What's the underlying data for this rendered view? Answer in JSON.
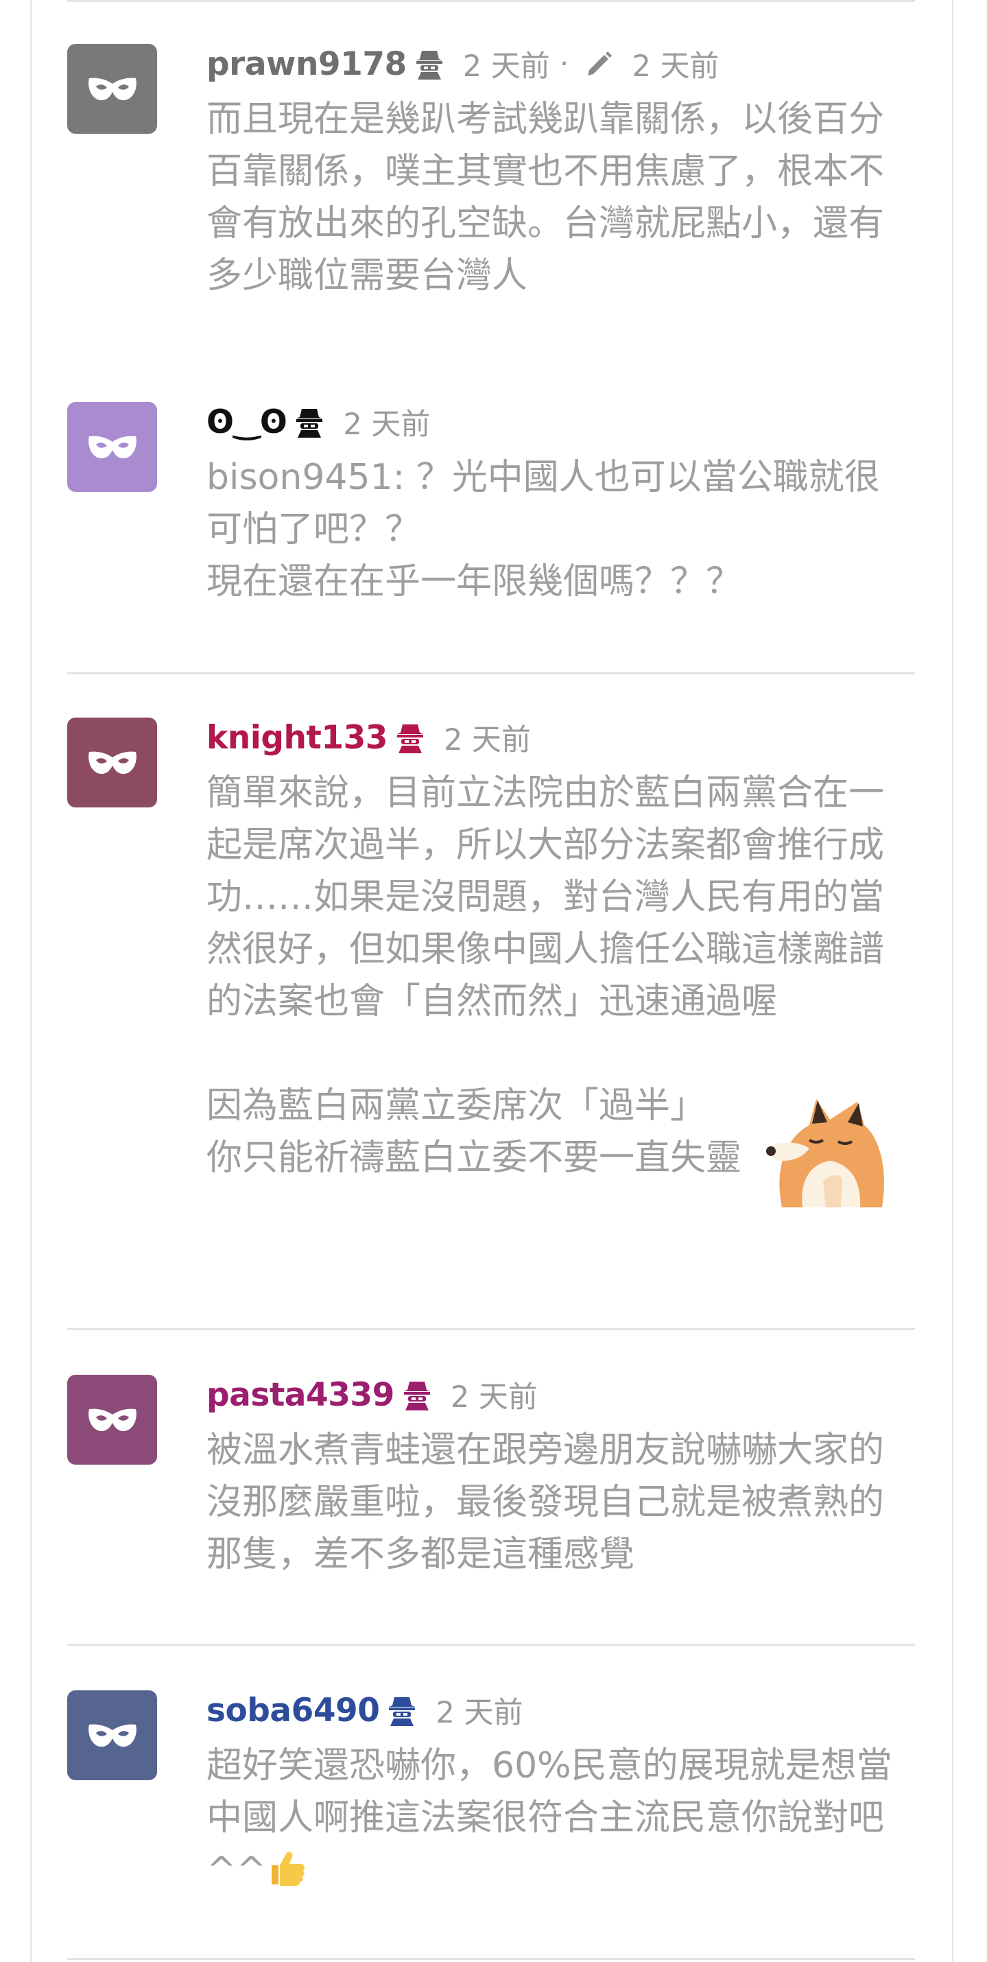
{
  "comments": [
    {
      "username": "prawn9178",
      "username_color": "#6f6f6f",
      "avatar_color": "#7a7878",
      "time": "2 天前",
      "edited_sep": "·",
      "edited_time": "2 天前",
      "text": "而且現在是幾趴考試幾趴靠關係，以後百分百靠關係，噗主其實也不用焦慮了，根本不會有放出來的孔空缺。台灣就屁點小，還有多少職位需要台灣人"
    },
    {
      "username": "ʘ‿ʘ",
      "username_color": "#111111",
      "avatar_color": "#a98bd0",
      "time": "2 天前",
      "text": "bison9451: ？光中國人也可以當公職就很可怕了吧？？\n現在還在在乎一年限幾個嗎？？？"
    },
    {
      "username": "knight133",
      "username_color": "#b3174d",
      "avatar_color": "#8d4a63",
      "time": "2 天前",
      "text": "簡單來說，目前立法院由於藍白兩黨合在一起是席次過半，所以大部分法案都會推行成功……如果是沒問題，對台灣人民有用的當然很好，但如果像中國人擔任公職這樣離譜的法案也會「自然而然」迅速通過喔\n\n因為藍白兩黨立委席次「過半」\n你只能祈禱藍白立委不要一直失靈"
    },
    {
      "username": "pasta4339",
      "username_color": "#9c1e6e",
      "avatar_color": "#8b4a78",
      "time": "2 天前",
      "text": "被溫水煮青蛙還在跟旁邊朋友說嚇嚇大家的沒那麼嚴重啦，最後發現自己就是被煮熟的那隻，差不多都是這種感覺"
    },
    {
      "username": "soba6490",
      "username_color": "#2d4d9a",
      "avatar_color": "#56658f",
      "time": "2 天前",
      "text": "超好笑還恐嚇你，60%民意的展現就是想當中國人啊推這法案很符合主流民意你說對吧^^"
    }
  ],
  "icons": {
    "avatar": "mask-icon",
    "badge": "anonymous-hat-icon",
    "edit": "pencil-icon",
    "sticker": "fox-sticker",
    "emoji": "thumbs-up-emoji"
  }
}
